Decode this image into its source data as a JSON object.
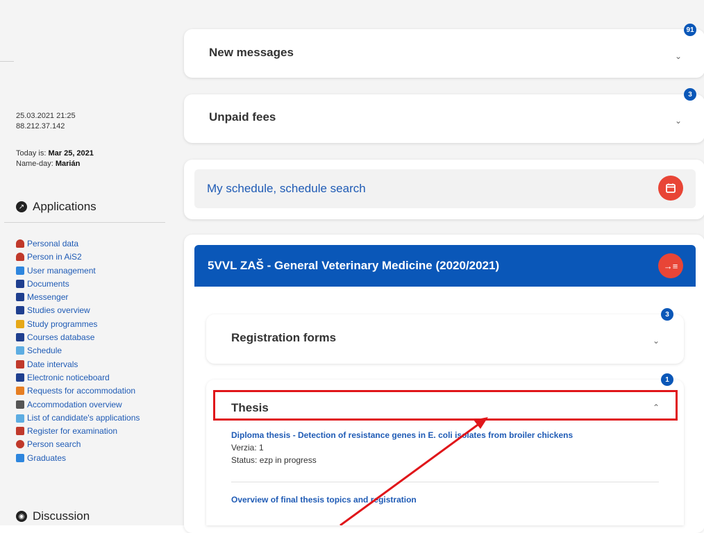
{
  "sidebar": {
    "session": {
      "datetime": "25.03.2021 21:25",
      "ip": "88.212.37.142"
    },
    "today_label": "Today is: ",
    "today_value": "Mar 25, 2021",
    "nameday_label": "Name-day: ",
    "nameday_value": "Marián",
    "applications_title": "Applications",
    "applications": [
      {
        "label": "Personal data",
        "icon": "person-icon",
        "color": "#c0392b"
      },
      {
        "label": "Person in AiS2",
        "icon": "person-icon",
        "color": "#c0392b"
      },
      {
        "label": "User management",
        "icon": "users-tree-icon",
        "color": "#2e86de"
      },
      {
        "label": "Documents",
        "icon": "document-icon",
        "color": "#1f3f8f"
      },
      {
        "label": "Messenger",
        "icon": "message-icon",
        "color": "#1f3f8f"
      },
      {
        "label": "Studies overview",
        "icon": "studies-icon",
        "color": "#1f3f8f"
      },
      {
        "label": "Study programmes",
        "icon": "list-icon",
        "color": "#e6a817"
      },
      {
        "label": "Courses database",
        "icon": "courses-icon",
        "color": "#1f3f8f"
      },
      {
        "label": "Schedule",
        "icon": "schedule-icon",
        "color": "#5dade2"
      },
      {
        "label": "Date intervals",
        "icon": "calendar-grid-icon",
        "color": "#c0392b"
      },
      {
        "label": "Electronic noticeboard",
        "icon": "noticeboard-icon",
        "color": "#1f3f8f"
      },
      {
        "label": "Requests for accommodation",
        "icon": "accommodation-request-icon",
        "color": "#e67e22"
      },
      {
        "label": "Accommodation overview",
        "icon": "dots-grid-icon",
        "color": "#555555"
      },
      {
        "label": "List of candidate's applications",
        "icon": "checkbox-icon",
        "color": "#5dade2"
      },
      {
        "label": "Register for examination",
        "icon": "exam-icon",
        "color": "#c0392b"
      },
      {
        "label": "Person search",
        "icon": "person-search-icon",
        "color": "#c0392b"
      },
      {
        "label": "Graduates",
        "icon": "graduates-icon",
        "color": "#2e86de"
      }
    ],
    "discussion_title": "Discussion"
  },
  "main": {
    "new_messages": {
      "title": "New messages",
      "badge": "91"
    },
    "unpaid_fees": {
      "title": "Unpaid fees",
      "badge": "3"
    },
    "schedule": {
      "title": "My schedule, schedule search"
    },
    "study": {
      "title": "5VVL ZAŠ - General Veterinary Medicine (2020/2021)"
    },
    "registration_forms": {
      "title": "Registration forms",
      "badge": "3"
    },
    "thesis": {
      "title": "Thesis",
      "badge": "1",
      "link": "Diploma thesis - Detection of resistance genes in E. coli isolates from broiler chickens",
      "version": "Verzia: 1",
      "status": "Status: ezp in progress",
      "overview_link": "Overview of final thesis topics and registration"
    }
  },
  "colors": {
    "accent": "#0a57b8",
    "red_button": "#e84536",
    "highlight": "#e0161a",
    "link": "#1f5bb5"
  }
}
